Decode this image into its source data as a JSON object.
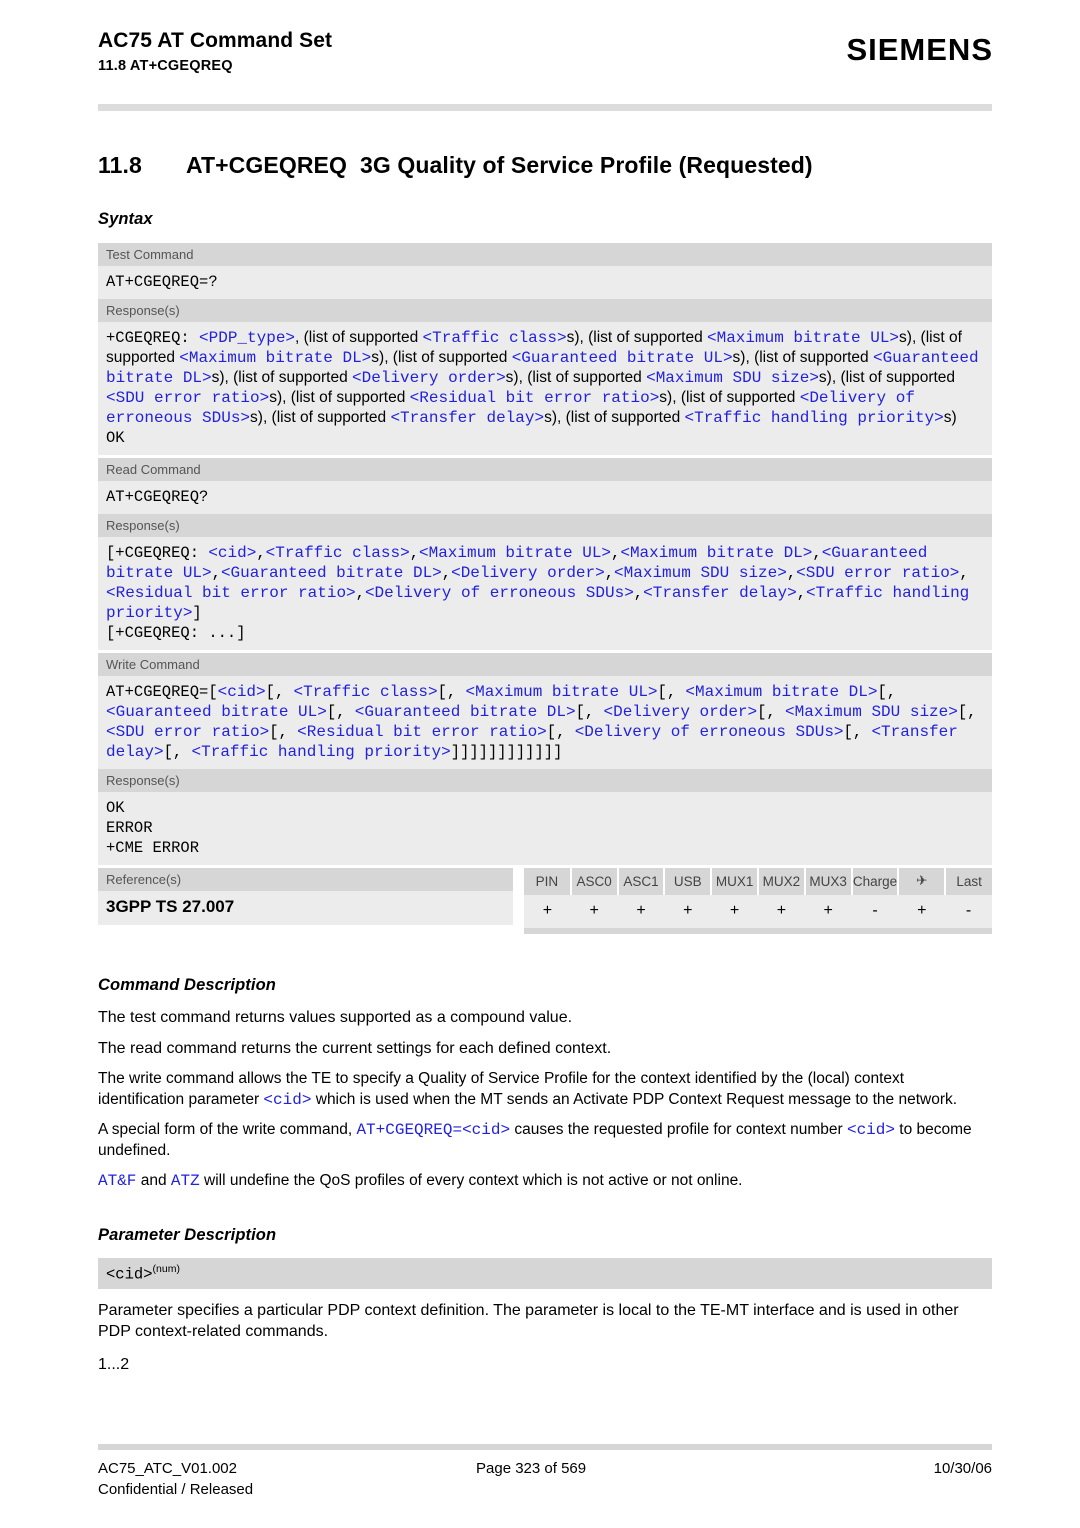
{
  "header": {
    "title": "AC75 AT Command Set",
    "subtitle": "11.8 AT+CGEQREQ",
    "logo": "SIEMENS"
  },
  "section": {
    "number": "11.8",
    "command": "AT+CGEQREQ",
    "title": "3G Quality of Service Profile (Requested)"
  },
  "headings": {
    "syntax": "Syntax",
    "command_description": "Command Description",
    "parameter_description": "Parameter Description"
  },
  "syntax": {
    "test": {
      "label": "Test Command",
      "command": "AT+CGEQREQ=?",
      "response_label": "Response(s)",
      "response_tokens": [
        {
          "t": "+CGEQREQ: ",
          "k": "code"
        },
        {
          "t": "<PDP_type>",
          "k": "param"
        },
        {
          "t": ", (list of supported ",
          "k": "prose"
        },
        {
          "t": "<Traffic class>",
          "k": "param"
        },
        {
          "t": "s), (list of supported ",
          "k": "prose"
        },
        {
          "t": "<Maximum bitrate UL>",
          "k": "param"
        },
        {
          "t": "s), (list of supported ",
          "k": "prose"
        },
        {
          "t": "<Maximum bitrate DL>",
          "k": "param"
        },
        {
          "t": "s), (list of supported ",
          "k": "prose"
        },
        {
          "t": "<Guaranteed bitrate UL>",
          "k": "param"
        },
        {
          "t": "s), (list of supported ",
          "k": "prose"
        },
        {
          "t": "<Guaranteed bitrate DL>",
          "k": "param"
        },
        {
          "t": "s), (list of supported ",
          "k": "prose"
        },
        {
          "t": "<Delivery order>",
          "k": "param"
        },
        {
          "t": "s), (list of supported ",
          "k": "prose"
        },
        {
          "t": "<Maximum SDU size>",
          "k": "param"
        },
        {
          "t": "s), (list of supported ",
          "k": "prose"
        },
        {
          "t": "<SDU error ratio>",
          "k": "param"
        },
        {
          "t": "s), (list of supported ",
          "k": "prose"
        },
        {
          "t": "<Residual bit error ratio>",
          "k": "param"
        },
        {
          "t": "s), (list of supported ",
          "k": "prose"
        },
        {
          "t": "<Delivery of erroneous SDUs>",
          "k": "param"
        },
        {
          "t": "s), (list of supported ",
          "k": "prose"
        },
        {
          "t": "<Transfer delay>",
          "k": "param"
        },
        {
          "t": "s), (list of supported ",
          "k": "prose"
        },
        {
          "t": "<Traffic handling priority>",
          "k": "param"
        },
        {
          "t": "s)",
          "k": "prose"
        }
      ],
      "response_trailer": "OK"
    },
    "read": {
      "label": "Read Command",
      "command": "AT+CGEQREQ?",
      "response_label": "Response(s)",
      "response_tokens": [
        {
          "t": "[+CGEQREQ: ",
          "k": "code"
        },
        {
          "t": "<cid>",
          "k": "param"
        },
        {
          "t": ",",
          "k": "code"
        },
        {
          "t": "<Traffic class>",
          "k": "param"
        },
        {
          "t": ",",
          "k": "code"
        },
        {
          "t": "<Maximum bitrate UL>",
          "k": "param"
        },
        {
          "t": ",",
          "k": "code"
        },
        {
          "t": "<Maximum bitrate DL>",
          "k": "param"
        },
        {
          "t": ",",
          "k": "code"
        },
        {
          "t": "<Guaranteed bitrate UL>",
          "k": "param"
        },
        {
          "t": ",",
          "k": "code"
        },
        {
          "t": "<Guaranteed bitrate DL>",
          "k": "param"
        },
        {
          "t": ",",
          "k": "code"
        },
        {
          "t": "<Delivery order>",
          "k": "param"
        },
        {
          "t": ",",
          "k": "code"
        },
        {
          "t": "<Maximum SDU size>",
          "k": "param"
        },
        {
          "t": ",",
          "k": "code"
        },
        {
          "t": "<SDU error ratio>",
          "k": "param"
        },
        {
          "t": ",",
          "k": "code"
        },
        {
          "t": "<Residual bit error ratio>",
          "k": "param"
        },
        {
          "t": ",",
          "k": "code"
        },
        {
          "t": "<Delivery of erroneous SDUs>",
          "k": "param"
        },
        {
          "t": ",",
          "k": "code"
        },
        {
          "t": "<Transfer delay>",
          "k": "param"
        },
        {
          "t": ",",
          "k": "code"
        },
        {
          "t": "<Traffic handling priority>",
          "k": "param"
        },
        {
          "t": "]",
          "k": "code"
        }
      ],
      "response_trailer": "[+CGEQREQ: ...]"
    },
    "write": {
      "label": "Write Command",
      "command_tokens": [
        {
          "t": "AT+CGEQREQ=[",
          "k": "code"
        },
        {
          "t": "<cid>",
          "k": "param"
        },
        {
          "t": "[, ",
          "k": "code"
        },
        {
          "t": "<Traffic class>",
          "k": "param"
        },
        {
          "t": "[, ",
          "k": "code"
        },
        {
          "t": "<Maximum bitrate UL>",
          "k": "param"
        },
        {
          "t": "[, ",
          "k": "code"
        },
        {
          "t": "<Maximum bitrate DL>",
          "k": "param"
        },
        {
          "t": "[, ",
          "k": "code"
        },
        {
          "t": "<Guaranteed bitrate UL>",
          "k": "param"
        },
        {
          "t": "[, ",
          "k": "code"
        },
        {
          "t": "<Guaranteed bitrate DL>",
          "k": "param"
        },
        {
          "t": "[, ",
          "k": "code"
        },
        {
          "t": "<Delivery order>",
          "k": "param"
        },
        {
          "t": "[, ",
          "k": "code"
        },
        {
          "t": "<Maximum SDU size>",
          "k": "param"
        },
        {
          "t": "[, ",
          "k": "code"
        },
        {
          "t": "<SDU error ratio>",
          "k": "param"
        },
        {
          "t": "[, ",
          "k": "code"
        },
        {
          "t": "<Residual bit error ratio>",
          "k": "param"
        },
        {
          "t": "[, ",
          "k": "code"
        },
        {
          "t": "<Delivery of erroneous SDUs>",
          "k": "param"
        },
        {
          "t": "[, ",
          "k": "code"
        },
        {
          "t": "<Transfer delay>",
          "k": "param"
        },
        {
          "t": "[, ",
          "k": "code"
        },
        {
          "t": "<Traffic handling priority>",
          "k": "param"
        },
        {
          "t": "]]]]]]]]]]]]",
          "k": "code"
        }
      ],
      "response_label": "Response(s)",
      "responses": [
        "OK",
        "ERROR",
        "+CME ERROR"
      ]
    },
    "reference": {
      "label": "Reference(s)",
      "value": "3GPP TS 27.007"
    },
    "capabilities": {
      "columns": [
        "PIN",
        "ASC0",
        "ASC1",
        "USB",
        "MUX1",
        "MUX2",
        "MUX3",
        "Charge",
        "airplane-icon",
        "Last"
      ],
      "values": [
        "+",
        "+",
        "+",
        "+",
        "+",
        "+",
        "+",
        "-",
        "+",
        "-"
      ],
      "airplane_glyph": "✈"
    }
  },
  "command_description": {
    "p1": "The test command returns values supported as a compound value.",
    "p2": "The read command returns the current settings for each defined context.",
    "p3_tokens": [
      {
        "t": "The write command allows the TE to specify a Quality of Service Profile for the context identified by the (local) context identification parameter ",
        "k": "prose"
      },
      {
        "t": "<cid>",
        "k": "param"
      },
      {
        "t": " which is used when the MT sends an Activate PDP Context Request message to the network.",
        "k": "prose"
      }
    ],
    "p4_tokens": [
      {
        "t": "A special form of the write command, ",
        "k": "prose"
      },
      {
        "t": "AT+CGEQREQ=",
        "k": "paramblk"
      },
      {
        "t": "<cid>",
        "k": "param"
      },
      {
        "t": " causes the requested profile for context number ",
        "k": "prose"
      },
      {
        "t": "<cid>",
        "k": "param"
      },
      {
        "t": " to become undefined.",
        "k": "prose"
      }
    ],
    "p5_tokens": [
      {
        "t": "AT&F",
        "k": "param"
      },
      {
        "t": " and ",
        "k": "prose"
      },
      {
        "t": "ATZ",
        "k": "param"
      },
      {
        "t": " will undefine the QoS profiles of every context which is not active or not online.",
        "k": "prose"
      }
    ]
  },
  "parameter_description": {
    "name": "<cid>",
    "superscript": "(num)",
    "text": "Parameter specifies a particular PDP context definition. The parameter is local to the TE-MT interface and is used in other PDP context-related commands.",
    "range": "1...2"
  },
  "footer": {
    "doc_id": "AC75_ATC_V01.002",
    "classification": "Confidential / Released",
    "page": "Page 323 of 569",
    "date": "10/30/06"
  }
}
